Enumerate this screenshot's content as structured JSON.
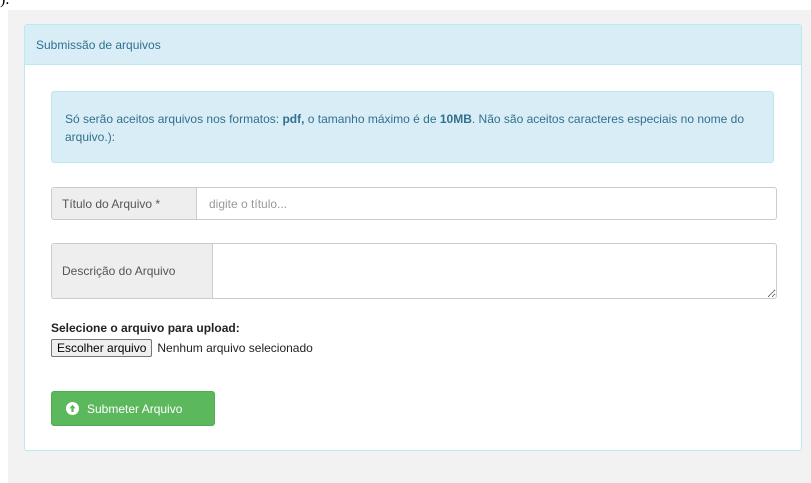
{
  "corner_glyph": ").",
  "panel": {
    "title": "Submissão de arquivos"
  },
  "alert": {
    "part1": "Só serão aceitos arquivos nos formatos: ",
    "format": "pdf,",
    "part2": " o tamanho máximo é de ",
    "max_size": "10MB",
    "part3": ". Não são aceitos caracteres especiais no nome do arquivo.):"
  },
  "title_field": {
    "label": "Título do Arquivo *",
    "placeholder": "digite o título...",
    "value": ""
  },
  "description_field": {
    "label": "Descrição do Arquivo",
    "value": ""
  },
  "upload": {
    "label": "Selecione o arquivo para upload:",
    "button_label": "Escolher arquivo",
    "status": "Nenhum arquivo selecionado"
  },
  "submit": {
    "label": "Submeter Arquivo",
    "icon": "arrow-up-circle-icon"
  },
  "colors": {
    "panel_heading_bg": "#d9edf7",
    "alert_text": "#31708f",
    "submit_bg": "#5cb85c"
  }
}
